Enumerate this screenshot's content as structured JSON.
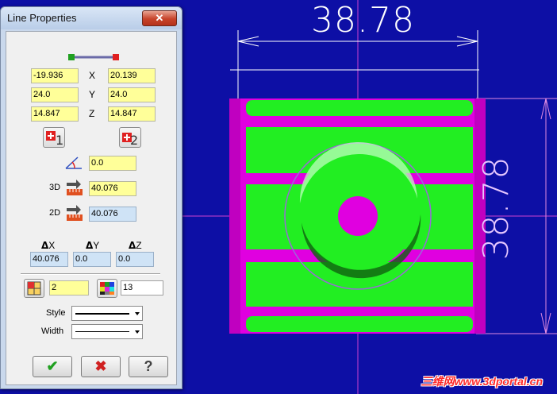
{
  "viewport": {
    "dimension_top": "38.78",
    "dimension_right": "38.78",
    "watermark": "三维网www.3dportal.cn"
  },
  "dialog": {
    "title": "Line Properties",
    "close_label": "✕",
    "point1": {
      "x": "-19.936",
      "y": "24.0",
      "z": "14.847"
    },
    "point2": {
      "x": "20.139",
      "y": "24.0",
      "z": "14.847"
    },
    "axis_x": "X",
    "axis_y": "Y",
    "axis_z": "Z",
    "angle_value": "0.0",
    "label_3d": "3D",
    "length_3d": "40.076",
    "label_2d": "2D",
    "length_2d": "40.076",
    "delta_x_label": "X",
    "delta_y_label": "Y",
    "delta_z_label": "Z",
    "delta_x": "40.076",
    "delta_y": "0.0",
    "delta_z": "0.0",
    "layer_value": "2",
    "color_value": "13",
    "style_label": "Style",
    "width_label": "Width",
    "ok_label": "✔",
    "cancel_label": "✖",
    "help_label": "?"
  },
  "colors": {
    "viewport_bg": "#0d0fa5",
    "part_green": "#22ee22",
    "part_magenta": "#e000e0",
    "field_yellow": "#ffff99",
    "field_blue": "#cfe3f6"
  }
}
